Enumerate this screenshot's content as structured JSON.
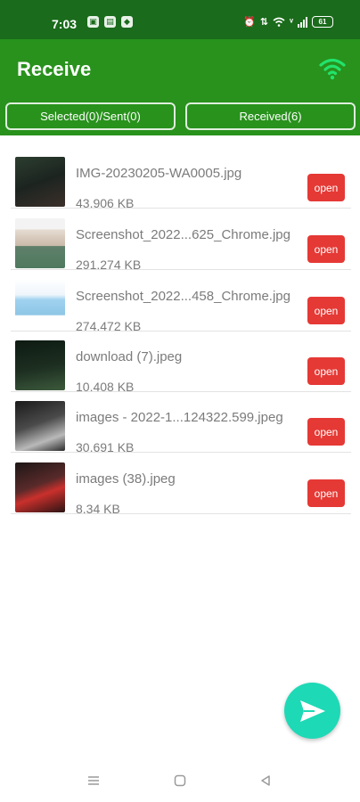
{
  "status_bar": {
    "time": "7:03",
    "battery": "61",
    "left_icons": [
      "notification-icon",
      "storage-icon",
      "shield-icon"
    ],
    "right_icons": [
      "alarm-icon",
      "data-icon",
      "wifi-icon",
      "volte-icon",
      "signal-icon",
      "battery-icon"
    ]
  },
  "header": {
    "title": "Receive"
  },
  "tabs": {
    "selected_sent": "Selected(0)/Sent(0)",
    "received": "Received(6)"
  },
  "files": [
    {
      "name": "IMG-20230205-WA0005.jpg",
      "size": "43.906 KB",
      "action": "open"
    },
    {
      "name": "Screenshot_2022...625_Chrome.jpg",
      "size": "291.274 KB",
      "action": "open"
    },
    {
      "name": "Screenshot_2022...458_Chrome.jpg",
      "size": "274.472 KB",
      "action": "open"
    },
    {
      "name": "download (7).jpeg",
      "size": "10.408 KB",
      "action": "open"
    },
    {
      "name": "images - 2022-1...124322.599.jpeg",
      "size": "30.691 KB",
      "action": "open"
    },
    {
      "name": "images (38).jpeg",
      "size": "8.34 KB",
      "action": "open"
    }
  ],
  "colors": {
    "status_bar": "#1a6b1b",
    "app_bar": "#28921c",
    "wifi_accent": "#22e36c",
    "open_button": "#e53935",
    "fab": "#1ed9b6"
  },
  "fab": {
    "icon": "send-icon"
  },
  "nav": {
    "icons": [
      "menu-icon",
      "home-icon",
      "back-icon"
    ]
  }
}
